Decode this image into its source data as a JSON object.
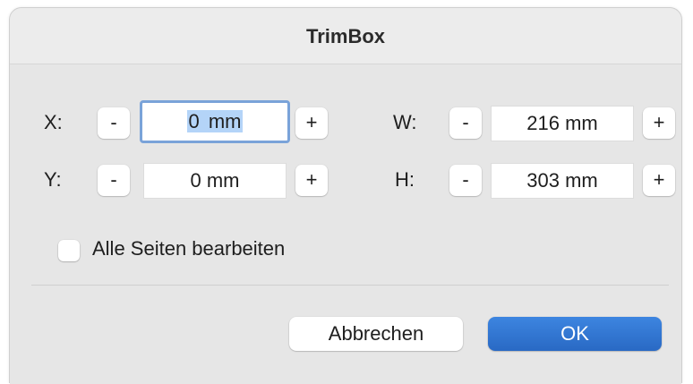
{
  "window": {
    "title": "TrimBox"
  },
  "fields": {
    "x": {
      "label": "X:",
      "value": "0 mm",
      "minus": "-",
      "plus": "+"
    },
    "y": {
      "label": "Y:",
      "value": "0 mm",
      "minus": "-",
      "plus": "+"
    },
    "w": {
      "label": "W:",
      "value": "216 mm",
      "minus": "-",
      "plus": "+"
    },
    "h": {
      "label": "H:",
      "value": "303 mm",
      "minus": "-",
      "plus": "+"
    }
  },
  "x_value_parts": {
    "number": "0",
    "unit": "mm"
  },
  "options": {
    "all_pages_label": "Alle Seiten bearbeiten",
    "all_pages_checked": false
  },
  "buttons": {
    "cancel_label": "Abbrechen",
    "ok_label": "OK"
  },
  "colors": {
    "accent": "#2f74d0",
    "focus_ring": "#7aa3d9",
    "selection": "#b4d4f8"
  }
}
